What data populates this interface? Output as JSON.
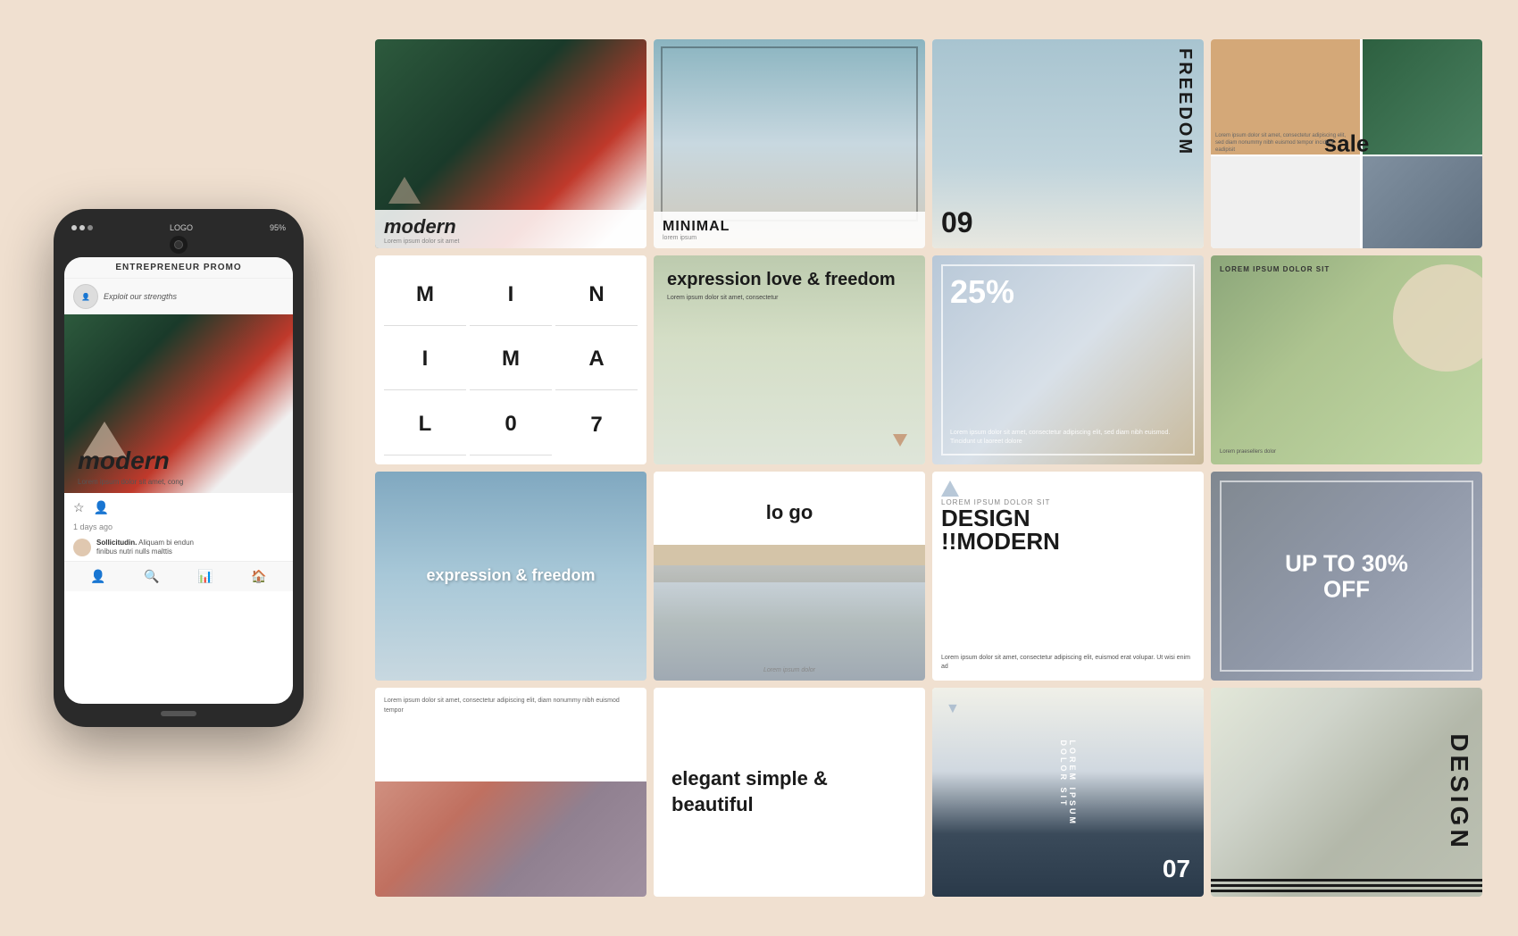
{
  "background_color": "#f0e0d0",
  "phone": {
    "app_name": "ENTREPRENEUR PROMO",
    "status": "95%",
    "logo": "LOGO",
    "username": "Exploit our strengths",
    "modern_text": "modern",
    "subtitle": "Lorem ipsum dolor sit amet, cong",
    "timestamp": "1 days ago",
    "comment_user": "Sollicitudin.",
    "comment_user2": "Aliquam",
    "comment_text": "bi endun",
    "comment_sub": "finibus nutri nulls malttis",
    "nav_icons": [
      "person-icon",
      "search-icon",
      "chart-icon",
      "home-icon"
    ]
  },
  "grid": {
    "row1": {
      "card1": {
        "label": "modern",
        "sub": "Lorem ipsum dolor sit amet"
      },
      "card2": {
        "title": "MINIMAL",
        "sub": "lorem ipsum"
      },
      "card3": {
        "number": "09",
        "text": "FREEDOM"
      },
      "card4": {
        "label": "sale",
        "sub": "Lorem ipsum dolor sit amet, consectetur adipiscing elit, sed diam nonummy nibh euismod tempor incidunt eadipisit"
      }
    },
    "row2": {
      "card1": {
        "letters": [
          "M",
          "I",
          "N",
          "I",
          "M",
          "A",
          "L",
          "0",
          "7"
        ]
      },
      "card2": {
        "title": "expression love & freedom",
        "sub": "Lorem ipsum dolor sit amet, consectetur"
      },
      "card3": {
        "percent": "25%",
        "sub": "Lorem ipsum dolor sit amet, consectetur adipiscing elit, sed diam nibh euismod. Tincidunt ut laoreet dolore"
      },
      "card4": {
        "text": "LOREM IPSUM DOLOR SIT",
        "sub": "Lorem praesellers dolor",
        "triangle": true
      }
    },
    "row3": {
      "card1": {
        "title": "expression & freedom"
      },
      "card2": {
        "logo": "lo\ngo",
        "sub": "Lorem ipsum dolor"
      },
      "card3": {
        "sit": "LOREM IPSUM DOLOR SIT",
        "design": "DESIGN",
        "modern": "!!MODERN",
        "sub": "Lorem ipsum dolor sit amet, consectetur adipiscing elit, euismod erat volupar. Ut wisi enim ad"
      },
      "card4": {
        "label": "UP TO\n30%\nOFF"
      }
    },
    "row4": {
      "card1": {
        "text": "Lorem ipsum dolor sit amet, consectetur adipiscing elit, diam nonummy nibh euismod tempor"
      },
      "card2": {
        "title": "elegant\nsimple\n& beautiful"
      },
      "card3": {
        "text": "LOREM IPSUM DOLOR SIT",
        "number": "07"
      },
      "card4": {
        "text": "DESIGN"
      }
    }
  }
}
